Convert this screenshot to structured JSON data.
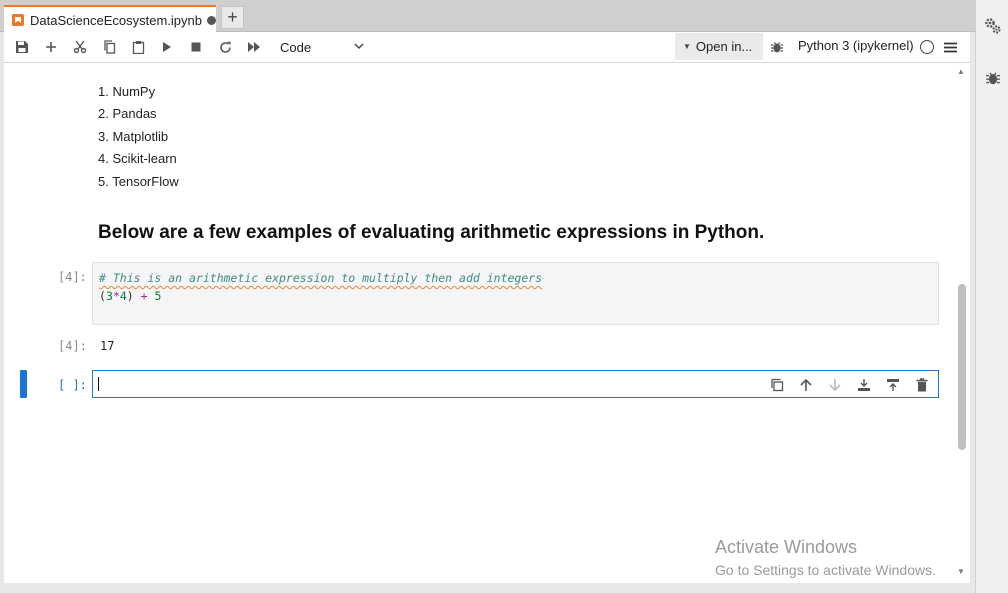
{
  "tab": {
    "title": "DataScienceEcosystem.ipynb"
  },
  "toolbar": {
    "cell_type": "Code",
    "open_in": "Open in...",
    "kernel": "Python 3 (ipykernel)"
  },
  "notebook": {
    "list": [
      "NumPy",
      "Pandas",
      "Matplotlib",
      "Scikit-learn",
      "TensorFlow"
    ],
    "list_numbers": [
      "1.",
      "2.",
      "3.",
      "4.",
      "5."
    ],
    "heading": "Below are a few examples of evaluating arithmetic expressions in Python.",
    "code_cell": {
      "prompt": "[4]:",
      "comment": "# This is an arithmetic expression to multiply then add integers",
      "code_open": "(",
      "code_n1": "3",
      "code_mul": "*",
      "code_n2": "4",
      "code_close": ") ",
      "code_plus": "+",
      "code_sp": " ",
      "code_n3": "5"
    },
    "output": {
      "prompt": "[4]:",
      "value": "17"
    },
    "active_cell": {
      "prompt": "[ ]:"
    }
  },
  "watermark": {
    "line1": "Activate Windows",
    "line2": "Go to Settings to activate Windows."
  },
  "colors": {
    "accent": "#1976d2",
    "tab_accent": "#f37626"
  }
}
